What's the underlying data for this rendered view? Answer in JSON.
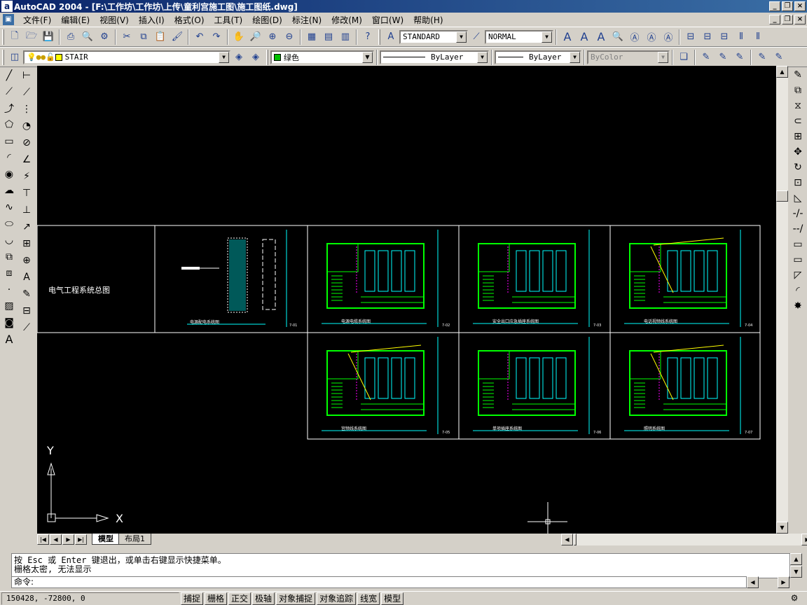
{
  "window": {
    "app_icon": "autocad-icon",
    "title": "AutoCAD 2004 - [F:\\工作坊\\工作坊\\上传\\童利宫施工图\\施工图纸.dwg]",
    "minimize": "_",
    "restore": "❐",
    "close": "×"
  },
  "menu": {
    "items": [
      "文件(F)",
      "编辑(E)",
      "视图(V)",
      "插入(I)",
      "格式(O)",
      "工具(T)",
      "绘图(D)",
      "标注(N)",
      "修改(M)",
      "窗口(W)",
      "帮助(H)"
    ]
  },
  "standard_toolbar": {
    "text_style": "STANDARD",
    "dim_style": "NORMAL"
  },
  "layers_toolbar": {
    "layer": "STAIR",
    "color": "绿色",
    "color_hex": "#00c000",
    "linetype": "ByLayer",
    "lineweight": "ByLayer",
    "plotstyle": "ByColor"
  },
  "drawing": {
    "sheet1_title": "电气工程系统总图",
    "frames": [
      {
        "caption": "电源配电系统图",
        "number": "7-01"
      },
      {
        "caption": "电源电缆系统图",
        "number": "7-02"
      },
      {
        "caption": "安全出口应急插座系统图",
        "number": "7-03"
      },
      {
        "caption": "电话视频线系统图",
        "number": "7-04"
      },
      {
        "caption": "宫频线系统图",
        "number": "7-05"
      },
      {
        "caption": "单项插座系统图",
        "number": "7-06"
      },
      {
        "caption": "照明系统图",
        "number": "7-07"
      }
    ],
    "ucs_x": "X",
    "ucs_y": "Y",
    "colors": {
      "background": "#000000",
      "frame": "#ffffff",
      "plan": "#00ff00",
      "cyan": "#00ffff",
      "magenta": "#ff00ff",
      "yellow": "#ffff00"
    }
  },
  "tabs": {
    "model": "模型",
    "layout1": "布局1"
  },
  "command": {
    "line1": "按 Esc 或 Enter 键退出，或单击右键显示快捷菜单。",
    "line2": "栅格太密, 无法显示",
    "prompt": "命令:"
  },
  "status": {
    "coordinates": "150428, -72800, 0",
    "buttons": [
      "捕捉",
      "栅格",
      "正交",
      "极轴",
      "对象捕捉",
      "对象追踪",
      "线宽",
      "模型"
    ]
  }
}
